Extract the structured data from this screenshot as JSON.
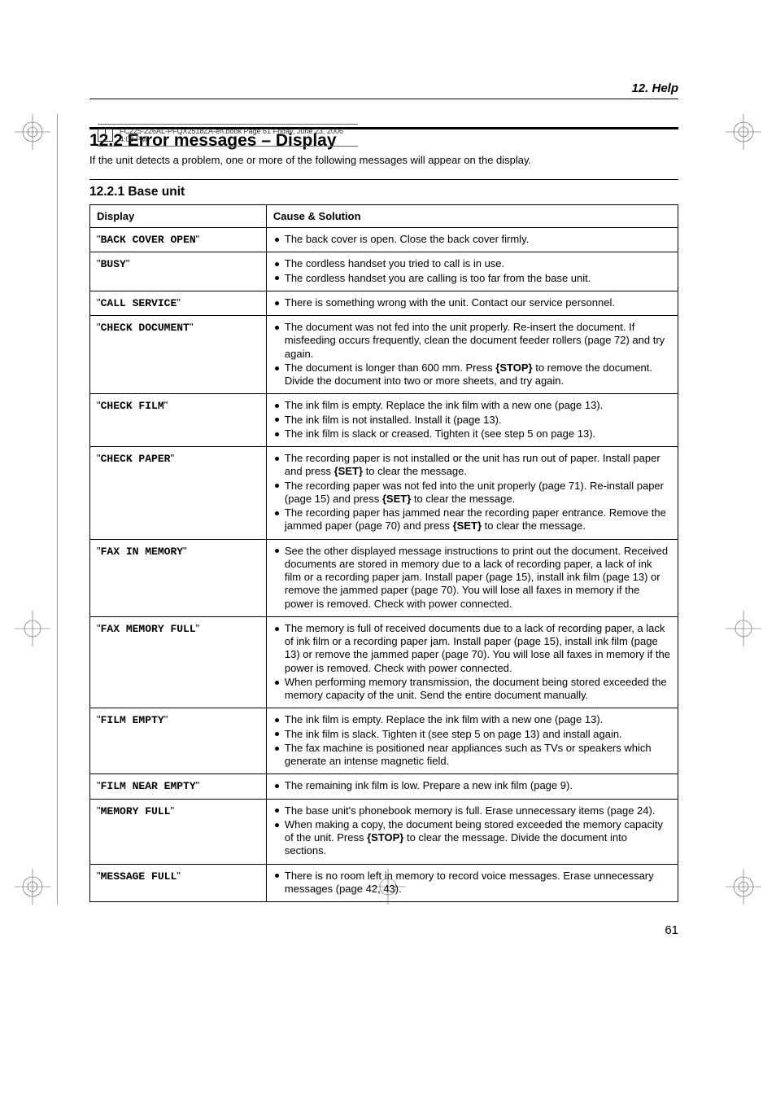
{
  "meta": {
    "bookfile": "FC225-226AL-PFQX2518ZA-en.book  Page 61  Friday, June 23, 2006  4:08 PM"
  },
  "header": {
    "running": "12. Help"
  },
  "section": {
    "number": "12.2",
    "title": "Error messages – Display",
    "intro": "If the unit detects a problem, one or more of the following messages will appear on the display."
  },
  "subsection": {
    "number": "12.2.1",
    "title": "Base unit"
  },
  "table": {
    "headers": {
      "c1": "Display",
      "c2": "Cause & Solution"
    },
    "rows": [
      {
        "display": "BACK COVER OPEN",
        "items": [
          {
            "text": "The back cover is open. Close the back cover firmly."
          }
        ]
      },
      {
        "display": "BUSY",
        "items": [
          {
            "text": "The cordless handset you tried to call is in use."
          },
          {
            "text": "The cordless handset you are calling is too far from the base unit."
          }
        ]
      },
      {
        "display": "CALL SERVICE",
        "items": [
          {
            "text": "There is something wrong with the unit. Contact our service personnel."
          }
        ]
      },
      {
        "display": "CHECK DOCUMENT",
        "items": [
          {
            "text": "The document was not fed into the unit properly. Re-insert the document. If misfeeding occurs frequently, clean the document feeder rollers (page 72) and try again."
          },
          {
            "text_pre": "The document is longer than 600 mm. Press ",
            "btn": "STOP",
            "text_post": " to remove the document. Divide the document into two or more sheets, and try again."
          }
        ]
      },
      {
        "display": "CHECK FILM",
        "items": [
          {
            "text": "The ink film is empty. Replace the ink film with a new one (page 13)."
          },
          {
            "text": "The ink film is not installed. Install it (page 13)."
          },
          {
            "text": "The ink film is slack or creased. Tighten it (see step 5 on page 13)."
          }
        ]
      },
      {
        "display": "CHECK PAPER",
        "items": [
          {
            "text_pre": "The recording paper is not installed or the unit has run out of paper. Install paper and press ",
            "btn": "SET",
            "text_post": " to clear the message."
          },
          {
            "text_pre": "The recording paper was not fed into the unit properly (page 71). Re-install paper (page 15) and press ",
            "btn": "SET",
            "text_post": " to clear the message."
          },
          {
            "text_pre": "The recording paper has jammed near the recording paper entrance. Remove the jammed paper (page 70) and press ",
            "btn": "SET",
            "text_post": " to clear the message."
          }
        ]
      },
      {
        "display": "FAX IN MEMORY",
        "items": [
          {
            "text": "See the other displayed message instructions to print out the document. Received documents are stored in memory due to a lack of recording paper, a lack of ink film or a recording paper jam. Install paper (page 15), install ink film (page 13) or remove the jammed paper (page 70). You will lose all faxes in memory if the power is removed. Check with power connected."
          }
        ]
      },
      {
        "display": "FAX MEMORY FULL",
        "items": [
          {
            "text": "The memory is full of received documents due to a lack of recording paper, a lack of ink film or a recording paper jam. Install paper (page 15), install ink film (page 13) or remove the jammed paper (page 70). You will lose all faxes in memory if the power is removed. Check with power connected."
          },
          {
            "text": "When performing memory transmission, the document being stored exceeded the memory capacity of the unit. Send the entire document manually."
          }
        ]
      },
      {
        "display": "FILM EMPTY",
        "items": [
          {
            "text": "The ink film is empty. Replace the ink film with a new one (page 13)."
          },
          {
            "text": "The ink film is slack. Tighten it (see step 5 on page 13) and install again."
          },
          {
            "text": "The fax machine is positioned near appliances such as TVs or speakers which generate an intense magnetic field."
          }
        ]
      },
      {
        "display": "FILM NEAR EMPTY",
        "items": [
          {
            "text": "The remaining ink film is low. Prepare a new ink film (page 9)."
          }
        ]
      },
      {
        "display": "MEMORY FULL",
        "items": [
          {
            "text": "The base unit's phonebook memory is full. Erase unnecessary items (page 24)."
          },
          {
            "text_pre": "When making a copy, the document being stored exceeded the memory capacity of the unit. Press ",
            "btn": "STOP",
            "text_post": " to clear the message. Divide the document into sections."
          }
        ]
      },
      {
        "display": "MESSAGE FULL",
        "items": [
          {
            "text": "There is no room left in memory to record voice messages. Erase unnecessary messages (page 42, 43)."
          }
        ]
      }
    ]
  },
  "footer": {
    "pagenum": "61"
  }
}
